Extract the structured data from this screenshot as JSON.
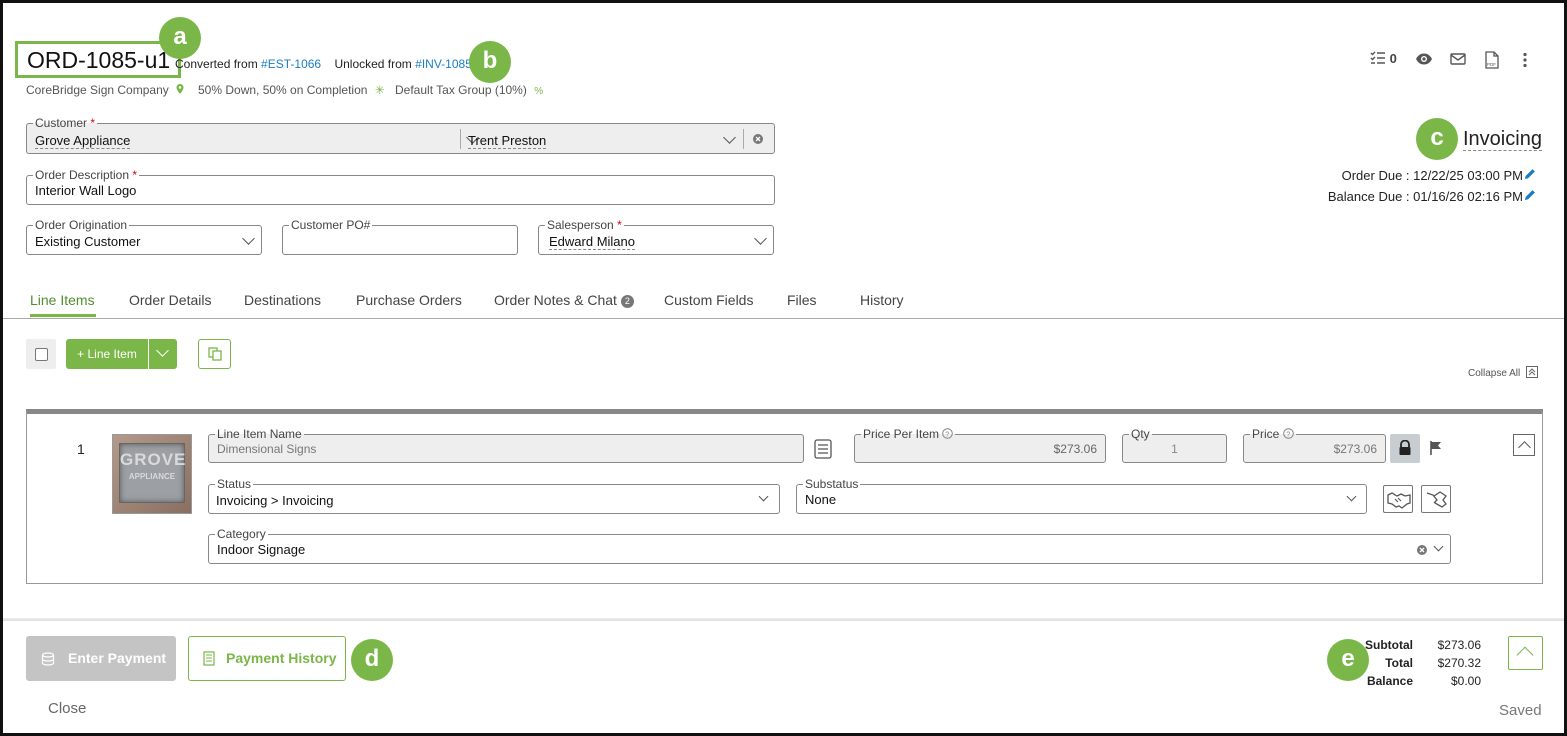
{
  "header": {
    "order_id": "ORD-1085-u1",
    "converted_prefix": "Converted from",
    "converted_link": "#EST-1066",
    "unlocked_prefix": "Unlocked from",
    "unlocked_link": "#INV-1085",
    "company": "CoreBridge Sign Company",
    "payment_terms": "50% Down, 50% on Completion",
    "tax_group": "Default Tax Group (10%)",
    "task_count": "0"
  },
  "callouts": {
    "a": "a",
    "b": "b",
    "c": "c",
    "d": "d",
    "e": "e"
  },
  "status": {
    "label": "Invoicing",
    "order_due": "Order Due : 12/22/25 03:00 PM",
    "balance_due": "Balance Due : 01/16/26 02:16 PM"
  },
  "form": {
    "customer_label": "Customer",
    "customer_value": "Grove Appliance",
    "contact_value": "Trent Preston",
    "description_label": "Order Description",
    "description_value": "Interior Wall Logo",
    "origination_label": "Order Origination",
    "origination_value": "Existing Customer",
    "po_label": "Customer PO#",
    "po_value": "",
    "salesperson_label": "Salesperson",
    "salesperson_value": "Edward Milano",
    "required_mark": "*"
  },
  "tabs": [
    {
      "label": "Line Items"
    },
    {
      "label": "Order Details"
    },
    {
      "label": "Destinations"
    },
    {
      "label": "Purchase Orders"
    },
    {
      "label": "Order Notes & Chat",
      "badge": "2"
    },
    {
      "label": "Custom Fields"
    },
    {
      "label": "Files"
    },
    {
      "label": "History"
    }
  ],
  "line_toolbar": {
    "add_label": "+ Line Item",
    "collapse_all": "Collapse All"
  },
  "line_item": {
    "number": "1",
    "thumb_line1": "GROVE",
    "thumb_line2": "APPLIANCE",
    "name_label": "Line Item Name",
    "name_value": "Dimensional Signs",
    "ppi_label": "Price Per Item",
    "ppi_value": "$273.06",
    "qty_label": "Qty",
    "qty_value": "1",
    "price_label": "Price",
    "price_value": "$273.06",
    "status_label": "Status",
    "status_value": "Invoicing > Invoicing",
    "substatus_label": "Substatus",
    "substatus_value": "None",
    "category_label": "Category",
    "category_value": "Indoor Signage"
  },
  "footer": {
    "enter_payment": "Enter Payment",
    "payment_history": "Payment History",
    "close": "Close",
    "saved": "Saved",
    "subtotal_label": "Subtotal",
    "subtotal_value": "$273.06",
    "total_label": "Total",
    "total_value": "$270.32",
    "balance_label": "Balance",
    "balance_value": "$0.00"
  },
  "colors": {
    "accent": "#7ab648",
    "link": "#1a7dc4",
    "required": "#d0021b"
  }
}
